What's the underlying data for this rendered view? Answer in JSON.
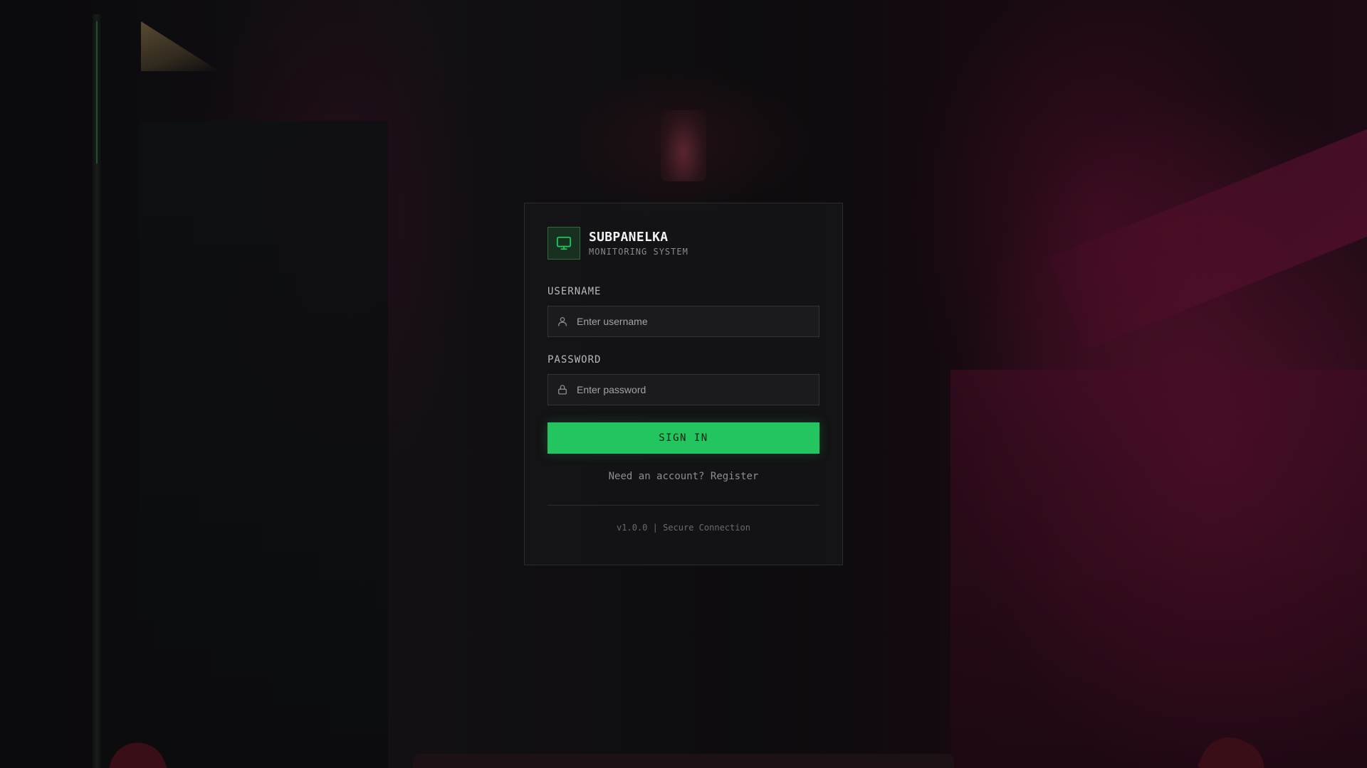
{
  "app": {
    "title": "SUBPANELKA",
    "subtitle": "MONITORING SYSTEM",
    "logo_icon": "monitor-icon",
    "accent_color": "#22c55e"
  },
  "form": {
    "username_label": "USERNAME",
    "username_placeholder": "Enter username",
    "username_value": "",
    "username_icon": "user-icon",
    "password_label": "PASSWORD",
    "password_placeholder": "Enter password",
    "password_value": "",
    "password_icon": "lock-icon",
    "submit_label": "SIGN IN"
  },
  "register": {
    "prompt": "Need an account?",
    "link_label": "Register"
  },
  "footer": {
    "version": "v1.0.0",
    "separator": "|",
    "status": "Secure Connection"
  }
}
